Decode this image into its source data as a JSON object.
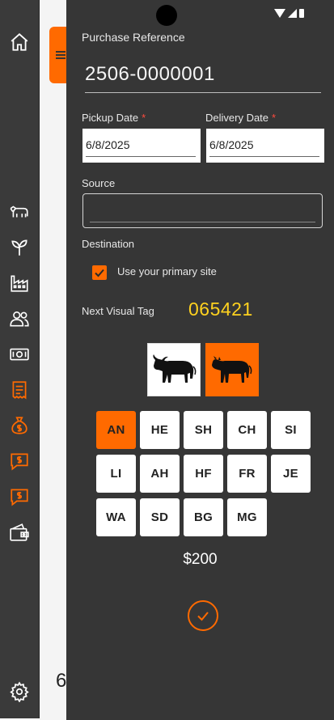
{
  "nav": {
    "items": [
      {
        "icon": "home-icon"
      },
      {
        "icon": "cattle-icon"
      },
      {
        "icon": "sprout-icon"
      },
      {
        "icon": "factory-icon"
      },
      {
        "icon": "people-icon"
      },
      {
        "icon": "cash-icon"
      },
      {
        "icon": "receipt-icon"
      },
      {
        "icon": "money-bag-icon"
      },
      {
        "icon": "dollar-chat-icon"
      },
      {
        "icon": "dollar-chat-icon"
      },
      {
        "icon": "wallet-icon"
      },
      {
        "icon": "settings-icon"
      }
    ],
    "active_color": "#ff6a00"
  },
  "background": {
    "partial_number": "6"
  },
  "form": {
    "purchase_reference_label": "Purchase Reference",
    "purchase_reference_value": "2506-0000001",
    "pickup_date_label": "Pickup Date",
    "pickup_date_value": "6/8/2025",
    "delivery_date_label": "Delivery Date",
    "delivery_date_value": "6/8/2025",
    "required_marker": "*",
    "source_label": "Source",
    "source_value": "",
    "destination_label": "Destination",
    "use_primary_site_label": "Use your primary site",
    "use_primary_site_checked": true,
    "next_visual_tag_label": "Next Visual Tag",
    "next_visual_tag_value": "065421",
    "animal_types": [
      {
        "icon": "bull-icon",
        "selected": false
      },
      {
        "icon": "cow-icon",
        "selected": true
      }
    ],
    "breeds": [
      {
        "code": "AN",
        "selected": true
      },
      {
        "code": "HE",
        "selected": false
      },
      {
        "code": "SH",
        "selected": false
      },
      {
        "code": "CH",
        "selected": false
      },
      {
        "code": "SI",
        "selected": false
      },
      {
        "code": "LI",
        "selected": false
      },
      {
        "code": "AH",
        "selected": false
      },
      {
        "code": "HF",
        "selected": false
      },
      {
        "code": "FR",
        "selected": false
      },
      {
        "code": "JE",
        "selected": false
      },
      {
        "code": "WA",
        "selected": false
      },
      {
        "code": "SD",
        "selected": false
      },
      {
        "code": "BG",
        "selected": false
      },
      {
        "code": "MG",
        "selected": false
      }
    ],
    "price": "$200",
    "accent_color": "#ff6a00",
    "tag_color": "#ffd21f"
  }
}
